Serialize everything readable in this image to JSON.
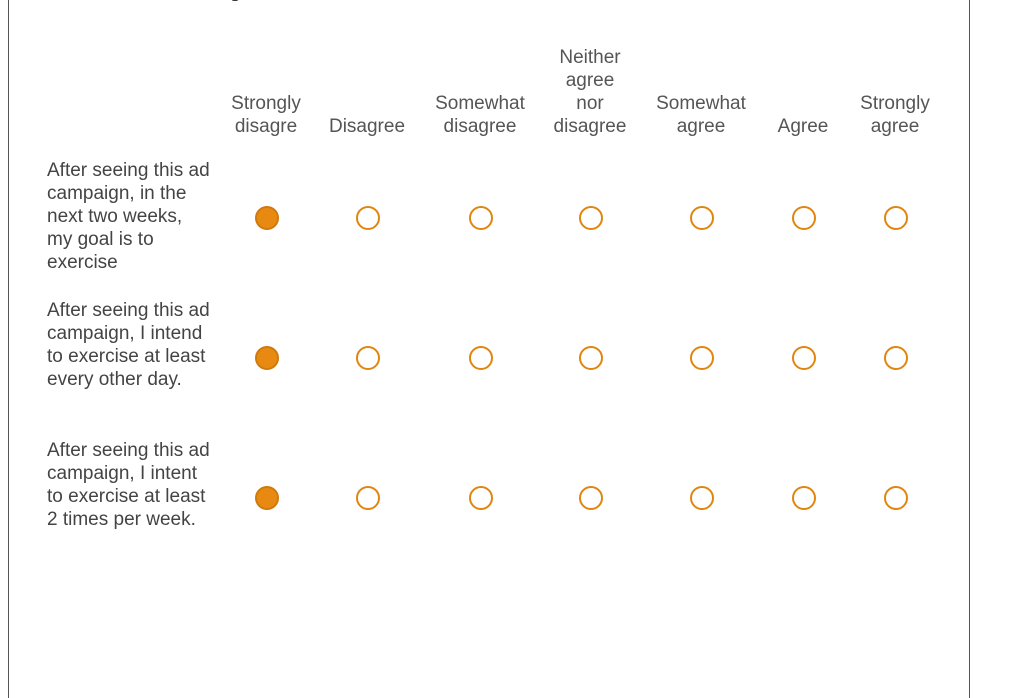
{
  "accent_color": "#e88a12",
  "scale": {
    "columns": [
      "Strongly\ndisagre",
      "Disagree",
      "Somewhat\ndisagree",
      "Neither\nagree\nnor\ndisagree",
      "Somewhat\nagree",
      "Agree",
      "Strongly\nagree"
    ]
  },
  "statements": [
    {
      "text": "After seeing this ad campaign, in the next two weeks, my goal is to exercise",
      "selected_index": 0
    },
    {
      "text": "After seeing this ad campaign, I intend to exercise at least every other day.",
      "selected_index": 0
    },
    {
      "text": "After seeing this ad campaign, I intent to exercise at least 2 times per week.",
      "selected_index": 0
    }
  ]
}
